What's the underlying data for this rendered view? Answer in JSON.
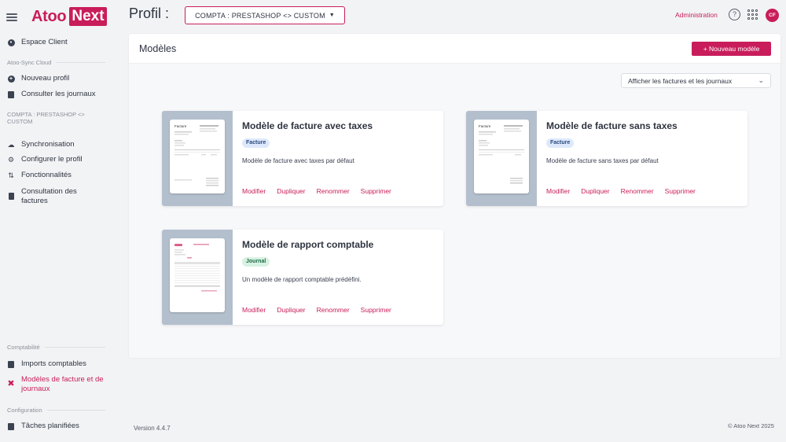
{
  "brand": {
    "part1": "Atoo",
    "part2": "Next"
  },
  "sidebar": {
    "top_item": "Espace Client",
    "section_cloud": "Atoo-Sync Cloud",
    "new_profile": "Nouveau profil",
    "journals": "Consulter les journaux",
    "profile_section": "COMPTA : PRESTASHOP <> CUSTOM",
    "sync": "Synchronisation",
    "configure": "Configurer le profil",
    "features": "Fonctionnalités",
    "invoices": "Consultation des factures",
    "section_compta": "Comptabilité",
    "imports": "Imports comptables",
    "models": "Modèles de facture et de journaux",
    "section_config": "Configuration",
    "tasks": "Tâches planifiées"
  },
  "header": {
    "profil_label": "Profil :",
    "profile_value": "COMPTA : PRESTASHOP <> CUSTOM",
    "admin": "Administration",
    "help": "?",
    "avatar": "CF"
  },
  "panel": {
    "title": "Modèles",
    "new_button": "+ Nouveau modèle",
    "filter_value": "Afficher les factures et les journaux"
  },
  "cards": [
    {
      "title": "Modèle de facture avec taxes",
      "tag": "Facture",
      "desc": "Modèle de facture avec taxes par défaut"
    },
    {
      "title": "Modèle de facture sans taxes",
      "tag": "Facture",
      "desc": "Modèle de facture sans taxes par défaut"
    },
    {
      "title": "Modèle de rapport comptable",
      "tag": "Journal",
      "desc": "Un modèle de rapport comptable prédéfini."
    }
  ],
  "actions": {
    "edit": "Modifier",
    "duplicate": "Dupliquer",
    "rename": "Renommer",
    "delete": "Supprimer"
  },
  "thumbnail": {
    "invoice_heading": "Facture"
  },
  "footer": {
    "version": "Version 4.4.7",
    "copyright": "© Atoo Next 2025"
  },
  "colors": {
    "accent": "#c81d5a",
    "thumb_bg": "#b3bfcc",
    "tag_facture": "#dde9fb",
    "tag_journal": "#d7f2e3"
  }
}
